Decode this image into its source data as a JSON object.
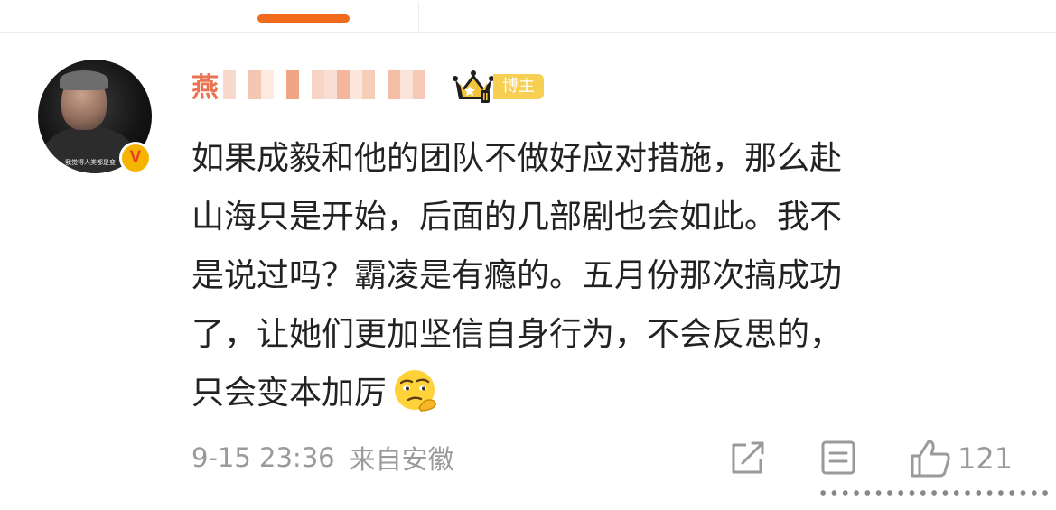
{
  "header": {
    "active_tab_color": "#f26b1d"
  },
  "post": {
    "author": {
      "name_visible": "燕",
      "name_obscured": true,
      "name_color": "#eb7350",
      "avatar_caption": "我觉得人类都是变",
      "verified_mark": "V",
      "member_icon": "crown-vip-icon",
      "role_badge": "博主"
    },
    "body_lines": [
      "如果成毅和他的团队不做好应对措施，那么赴",
      "山海只是开始，后面的几部剧也会如此。我不",
      "是说过吗？霸凌是有瘾的。五月份那次搞成功",
      "了，让她们更加坚信自身行为，不会反思的，",
      "只会变本加厉"
    ],
    "body_emoji": "thinking-face-emoji",
    "timestamp": "9-15 23:36",
    "source": "来自安徽",
    "actions": {
      "share_icon": "share-icon",
      "comment_icon": "comment-icon",
      "like_icon": "thumbs-up-icon",
      "like_count": "121"
    }
  }
}
